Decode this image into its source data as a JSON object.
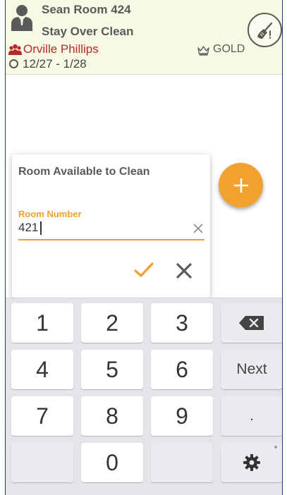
{
  "header": {
    "room_label": "Sean Room 424",
    "task_label": "Stay Over Clean",
    "guest_name": "Orville Phillips",
    "loyalty_tier": "GOLD",
    "stay_dates": "12/27 - 1/28"
  },
  "dialog": {
    "title": "Room Available to Clean",
    "field_label": "Room Number",
    "field_value": "421"
  },
  "keyboard": {
    "keys": [
      "1",
      "2",
      "3",
      "4",
      "5",
      "6",
      "7",
      "8",
      "9",
      "0"
    ],
    "next_label": "Next",
    "period_label": "."
  },
  "colors": {
    "accent": "#f2a22c",
    "guest": "#b82a2a",
    "header_bg": "#f8f9e4",
    "text": "#5a5a5a"
  },
  "icons": [
    "person-icon",
    "guest-icon",
    "crown-icon",
    "circle-icon",
    "broom-icon",
    "plus-icon",
    "clear-icon",
    "check-icon",
    "close-icon",
    "backspace-icon",
    "gear-icon"
  ]
}
